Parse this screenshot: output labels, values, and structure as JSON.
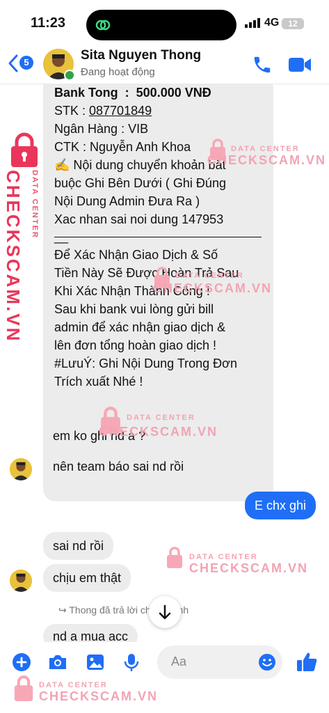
{
  "status_bar": {
    "time": "11:23",
    "network": "4G",
    "battery": "12"
  },
  "header": {
    "back_badge": "5",
    "contact_name": "Sita Nguyen Thong",
    "contact_status": "Đang hoạt động"
  },
  "messages": {
    "big_bubble": {
      "line1": "Bank Tong  :  500.000 VNĐ",
      "stk_label": "STK : ",
      "stk_value": "087701849",
      "line3": "Ngân Hàng : VIB",
      "line4": "CTK : Nguyễn Anh Khoa",
      "line5": "✍️ Nội dung chuyển khoản bắt",
      "line6": "buộc Ghi Bên Dưới ( Ghi Đúng",
      "line7": "Nội Dung Admin Đưa Ra )",
      "line8": "Xac nhan sai noi dung 147953",
      "line9": "__",
      "line10": "Để Xác Nhận Giao Dịch & Số",
      "line11": "Tiền Này Sẽ Được Hoàn Trả Sau",
      "line12": "Khi Xác Nhận Thành Công !",
      "line13": "Sau khi bank vui lòng gửi bill",
      "line14": "admin để xác nhận giao dịch &",
      "line15": "lên đơn tổng hoàn giao dịch !",
      "line16": "#LưuÝ: Ghi Nội Dung Trong Đơn",
      "line17": "Trích xuất Nhé !"
    },
    "msg_em_ko": "em ko ghi nd à ?",
    "msg_nen_team": "nên team báo sai nd rồi",
    "msg_mine": "E chx ghi",
    "msg_sai_nd": "sai nd rồi",
    "msg_chiu": "chịu em thật",
    "reply_note": "↪ Thong đã trả lời chính mình",
    "msg_partial": "nd a mua acc"
  },
  "composer": {
    "placeholder": "Aa"
  },
  "watermarks": {
    "small": "DATA CENTER",
    "big": "CHECKSCAM.VN"
  },
  "colors": {
    "accent": "#1f6ef5",
    "bubble_other": "#ececec",
    "watermark": "#f3a3b3",
    "online": "#31a24c"
  }
}
